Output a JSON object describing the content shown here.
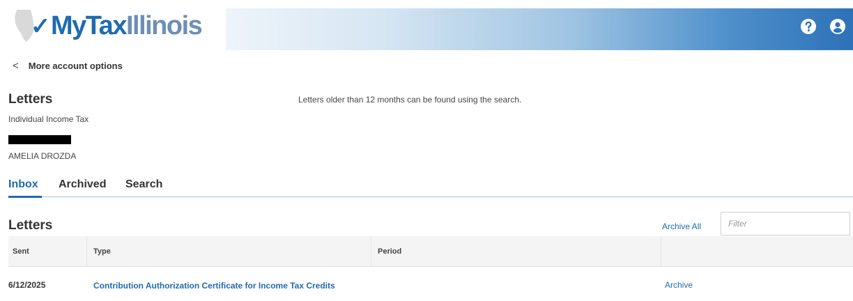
{
  "header": {
    "logo": {
      "check": "✓",
      "my": "MyTax",
      "state": "Illinois"
    },
    "icons": [
      "help-icon",
      "user-account-icon"
    ],
    "colors": {
      "brand_blue": "#1f6bb0",
      "banner_end": "#2d72b8"
    }
  },
  "nav": {
    "back_label": "More account options"
  },
  "page": {
    "title": "Letters",
    "notice": "Letters older than 12 months can be found using the search.",
    "subtitle": "Individual Income Tax",
    "name": "AMELIA DROZDA"
  },
  "tabs": [
    {
      "label": "Inbox",
      "active": true
    },
    {
      "label": "Archived",
      "active": false
    },
    {
      "label": "Search",
      "active": false
    }
  ],
  "letters": {
    "title": "Letters",
    "archive_all": "Archive All",
    "filter_placeholder": "Filter",
    "columns": [
      "Sent",
      "Type",
      "Period",
      ""
    ],
    "rows": [
      {
        "sent": "6/12/2025",
        "type": "Contribution Authorization Certificate for Income Tax Credits",
        "period": "",
        "action": "Archive"
      }
    ]
  }
}
